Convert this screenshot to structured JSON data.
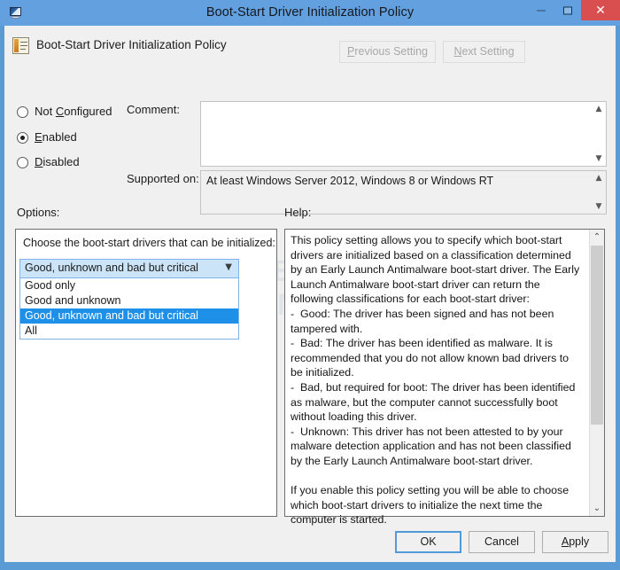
{
  "window": {
    "title": "Boot-Start Driver Initialization Policy",
    "app_icon": "policy-window-icon",
    "controls": {
      "minimize": "minimize-icon",
      "maximize": "maximize-icon",
      "close": "✕"
    }
  },
  "header": {
    "icon": "policy-setting-icon",
    "title": "Boot-Start Driver Initialization Policy",
    "previous_setting": "Previous Setting",
    "next_setting": "Next Setting",
    "previous_setting_enabled": false,
    "next_setting_enabled": false
  },
  "state": {
    "options": [
      {
        "label": "Not Configured",
        "selected": false
      },
      {
        "label": "Enabled",
        "selected": true
      },
      {
        "label": "Disabled",
        "selected": false
      }
    ]
  },
  "comment": {
    "label": "Comment:",
    "value": "",
    "placeholder": ""
  },
  "supported_on": {
    "label": "Supported on:",
    "value": "At least Windows Server 2012, Windows 8 or Windows RT"
  },
  "options_section": {
    "label": "Options:",
    "prompt": "Choose the boot-start drivers that can be initialized:",
    "combo": {
      "value": "Good, unknown and bad but critical",
      "expanded": true,
      "arrow_icon": "chevron-down-icon",
      "items": [
        {
          "label": "Good only",
          "selected": false
        },
        {
          "label": "Good and unknown",
          "selected": false
        },
        {
          "label": "Good, unknown and bad but critical",
          "selected": true
        },
        {
          "label": "All",
          "selected": false
        }
      ]
    }
  },
  "help_section": {
    "label": "Help:",
    "text": "This policy setting allows you to specify which boot-start drivers are initialized based on a classification determined by an Early Launch Antimalware boot-start driver. The Early Launch Antimalware boot-start driver can return the following classifications for each boot-start driver:\n-  Good: The driver has been signed and has not been tampered with.\n-  Bad: The driver has been identified as malware. It is recommended that you do not allow known bad drivers to be initialized.\n-  Bad, but required for boot: The driver has been identified as malware, but the computer cannot successfully boot without loading this driver.\n-  Unknown: This driver has not been attested to by your malware detection application and has not been classified by the Early Launch Antimalware boot-start driver.\n\nIf you enable this policy setting you will be able to choose which boot-start drivers to initialize the next time the computer is started.",
    "scrollbar": {
      "up_arrow": "⌃",
      "down_arrow": "⌄"
    }
  },
  "footer": {
    "ok": "OK",
    "cancel": "Cancel",
    "apply": "Apply"
  },
  "watermark": {
    "line1": "BLEEPING",
    "line2": "COMPUTER"
  },
  "colors": {
    "titlebar": "#63a0e0",
    "window_border": "#5b9bd5",
    "dialog_background": "#f0f0f0",
    "close_button": "#d94f4f",
    "selection_blue": "#1e90e8",
    "combo_open_fill": "#cbe4f7",
    "focus_border": "#4f9bdc"
  }
}
